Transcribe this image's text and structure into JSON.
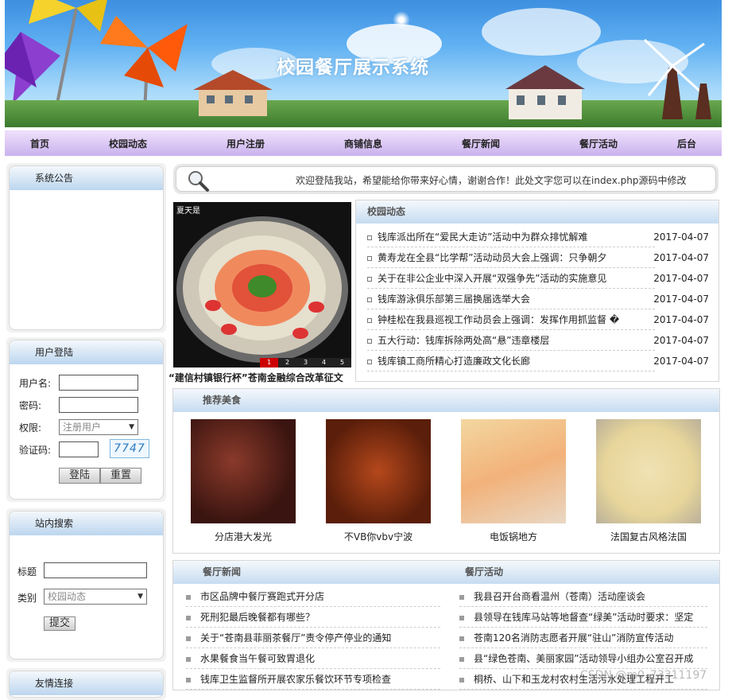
{
  "banner": {
    "title": "校园餐厅展示系统"
  },
  "nav": {
    "items": [
      "首页",
      "校园动态",
      "用户注册",
      "商铺信息",
      "餐厅新闻",
      "餐厅活动",
      "后台"
    ]
  },
  "notice": {
    "title": "系统公告"
  },
  "login": {
    "title": "用户登陆",
    "username_label": "用户名:",
    "password_label": "密码:",
    "role_label": "权限:",
    "role_value": "注册用户",
    "captcha_label": "验证码:",
    "captcha_code": "7747",
    "login_button": "登陆",
    "reset_button": "重置"
  },
  "search": {
    "title": "站内搜索",
    "keyword_label": "标题",
    "category_label": "类别",
    "category_value": "校园动态",
    "submit_button": "提交"
  },
  "links": {
    "title": "友情连接"
  },
  "welcome": {
    "text": "欢迎登陆我站，希望能给你带来好心情，谢谢合作！此处文字您可以在index.php源码中修改"
  },
  "slideshow": {
    "watermark": "夏天是",
    "caption": "“建信村镇银行杯”苍南金融综合改革征文",
    "pages": [
      "1",
      "2",
      "3",
      "4",
      "5"
    ],
    "active_page": "1"
  },
  "campus_news": {
    "title": "校园动态",
    "items": [
      {
        "text": "钱库派出所在“爱民大走访”活动中为群众排忧解难",
        "date": "2017-04-07"
      },
      {
        "text": "黄寿龙在全县“比学帮”活动动员大会上强调：只争朝夕",
        "date": "2017-04-07"
      },
      {
        "text": "关于在非公企业中深入开展“双强争先”活动的实施意见",
        "date": "2017-04-07"
      },
      {
        "text": "钱库游泳俱乐部第三届换届选举大会",
        "date": "2017-04-07"
      },
      {
        "text": "钟桂松在我县巡视工作动员会上强调：发挥作用抓监督 �",
        "date": "2017-04-07"
      },
      {
        "text": "五大行动：钱库拆除两处高“悬”违章楼层",
        "date": "2017-04-07"
      },
      {
        "text": "钱库镇工商所精心打造廉政文化长廊",
        "date": "2017-04-07"
      }
    ]
  },
  "recommended": {
    "title": "推荐美食",
    "items": [
      "分店港大发光",
      "不VB你vbv宁波",
      "电饭锅地方",
      "法国复古风格法国"
    ]
  },
  "restaurant_news": {
    "title": "餐厅新闻",
    "items": [
      "市区品牌中餐厅赛跑式开分店",
      "死刑犯最后晚餐都有哪些？",
      "关于“苍南县菲丽茶餐厅”责令停产停业的通知",
      "水果餐食当午餐可致胃退化",
      "钱库卫生监督所开展农家乐餐饮环节专项检查"
    ]
  },
  "restaurant_events": {
    "title": "餐厅活动",
    "items": [
      "我县召开台商看温州（苍南）活动座谈会",
      "县领导在钱库马站等地督查“绿美”活动时要求：坚定",
      "苍南120名消防志愿者开展“驻山”消防宣传活动",
      "县“绿色苍南、美丽家园”活动领导小组办公室召开成",
      "桐桥、山下和玉龙村农村生活污水处理工程开工"
    ]
  },
  "watermark": "CSDN @m0_73311197",
  "colors": {
    "nav_bg": "#d9c7f4",
    "panel_head": "#bcd6ef",
    "accent_red": "#cc0000"
  }
}
